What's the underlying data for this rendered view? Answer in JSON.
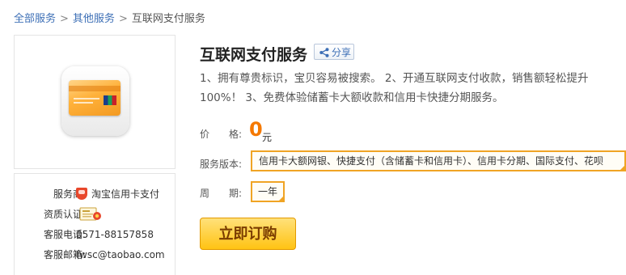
{
  "breadcrumb": {
    "items": [
      "全部服务",
      "其他服务",
      "互联网支付服务"
    ],
    "separator": ">"
  },
  "product": {
    "title": "互联网支付服务",
    "share_label": "分享",
    "description": "1、拥有尊贵标识，宝贝容易被搜索。 2、开通互联网支付收款，销售额轻松提升100%！ 3、免费体验储蓄卡大额收款和信用卡快捷分期服务。",
    "price_label": "价　　格:",
    "price": "0",
    "price_unit": "元",
    "version_label": "服务版本:",
    "version_value": "信用卡大额网银、快捷支付（含储蓄卡和信用卡）、信用卡分期、国际支付、花呗",
    "period_label": "周　　期:",
    "period_value": "一年",
    "order_button": "立即订购"
  },
  "info": {
    "provider_label": "服务商:",
    "provider_value": "淘宝信用卡支付",
    "cert_label": "资质认证:",
    "phone_label": "客服电话:",
    "phone_value": "0571-88157858",
    "email_label": "客服邮箱:",
    "email_value": "fwsc@taobao.com"
  },
  "colors": {
    "link": "#3d6fb6",
    "accent": "#f57900",
    "select_border": "#f0a424",
    "button": "#ffc313"
  }
}
